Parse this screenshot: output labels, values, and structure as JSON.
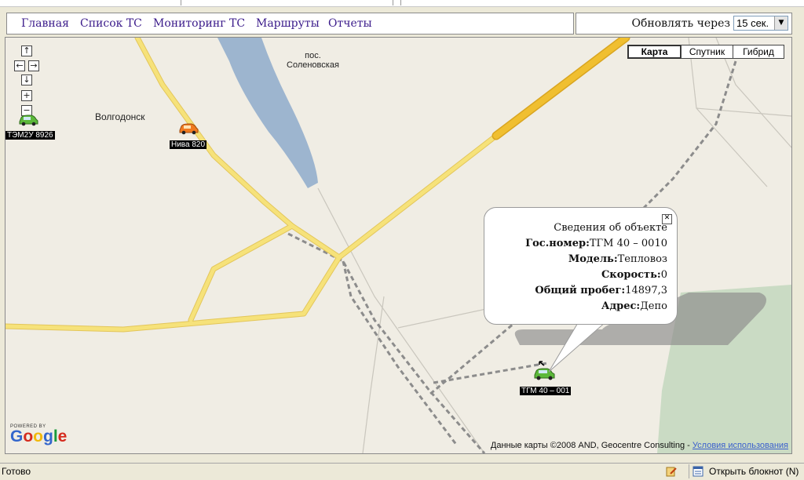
{
  "nav": {
    "items": [
      "Главная",
      "Список ТС",
      "Мониторинг ТС",
      "Маршруты",
      "Отчеты"
    ]
  },
  "refresh": {
    "label": "Обновлять через",
    "selected": "15 сек."
  },
  "map": {
    "controls": {
      "up": "↑",
      "left": "←",
      "right": "→",
      "down": "↓",
      "zoom_in": "+",
      "zoom_out": "−"
    },
    "types": [
      "Карта",
      "Спутник",
      "Гибрид"
    ],
    "active_type": "Карта",
    "places": {
      "volgodonsk": "Волгодонск",
      "solenovskaya": "пос.\nСоленовская"
    },
    "vehicles": [
      {
        "label": "ТЭМ2У 8926",
        "icon": "green-car-icon"
      },
      {
        "label": "Нива 820",
        "icon": "orange-car-icon"
      },
      {
        "label": "ТГМ 40 – 001",
        "icon": "green-car-arrow-icon"
      }
    ],
    "copyright": "Данные карты ©2008 AND, Geocentre Consulting -",
    "terms_link": "Условия использования",
    "powered_by": "POWERED BY",
    "brand": "Google"
  },
  "info_window": {
    "title": "Сведения об объекте",
    "fields": [
      {
        "label": "Гос.номер:",
        "value": "ТГМ  40 – 0010"
      },
      {
        "label": "Модель:",
        "value": "Тепловоз"
      },
      {
        "label": "Скорость:",
        "value": "0"
      },
      {
        "label": "Общий пробег:",
        "value": "14897,3"
      },
      {
        "label": "Адрес:",
        "value": "Депо"
      }
    ]
  },
  "status": {
    "text": "Готово",
    "notepad": "Открыть блокнот (N)"
  },
  "colors": {
    "road": "#f6e27a",
    "road_edge": "#e3c65a",
    "highway": "#f0bf30",
    "water": "#9db5cf",
    "green_area": "#cadbc4",
    "rail": "#8c8c8c"
  }
}
